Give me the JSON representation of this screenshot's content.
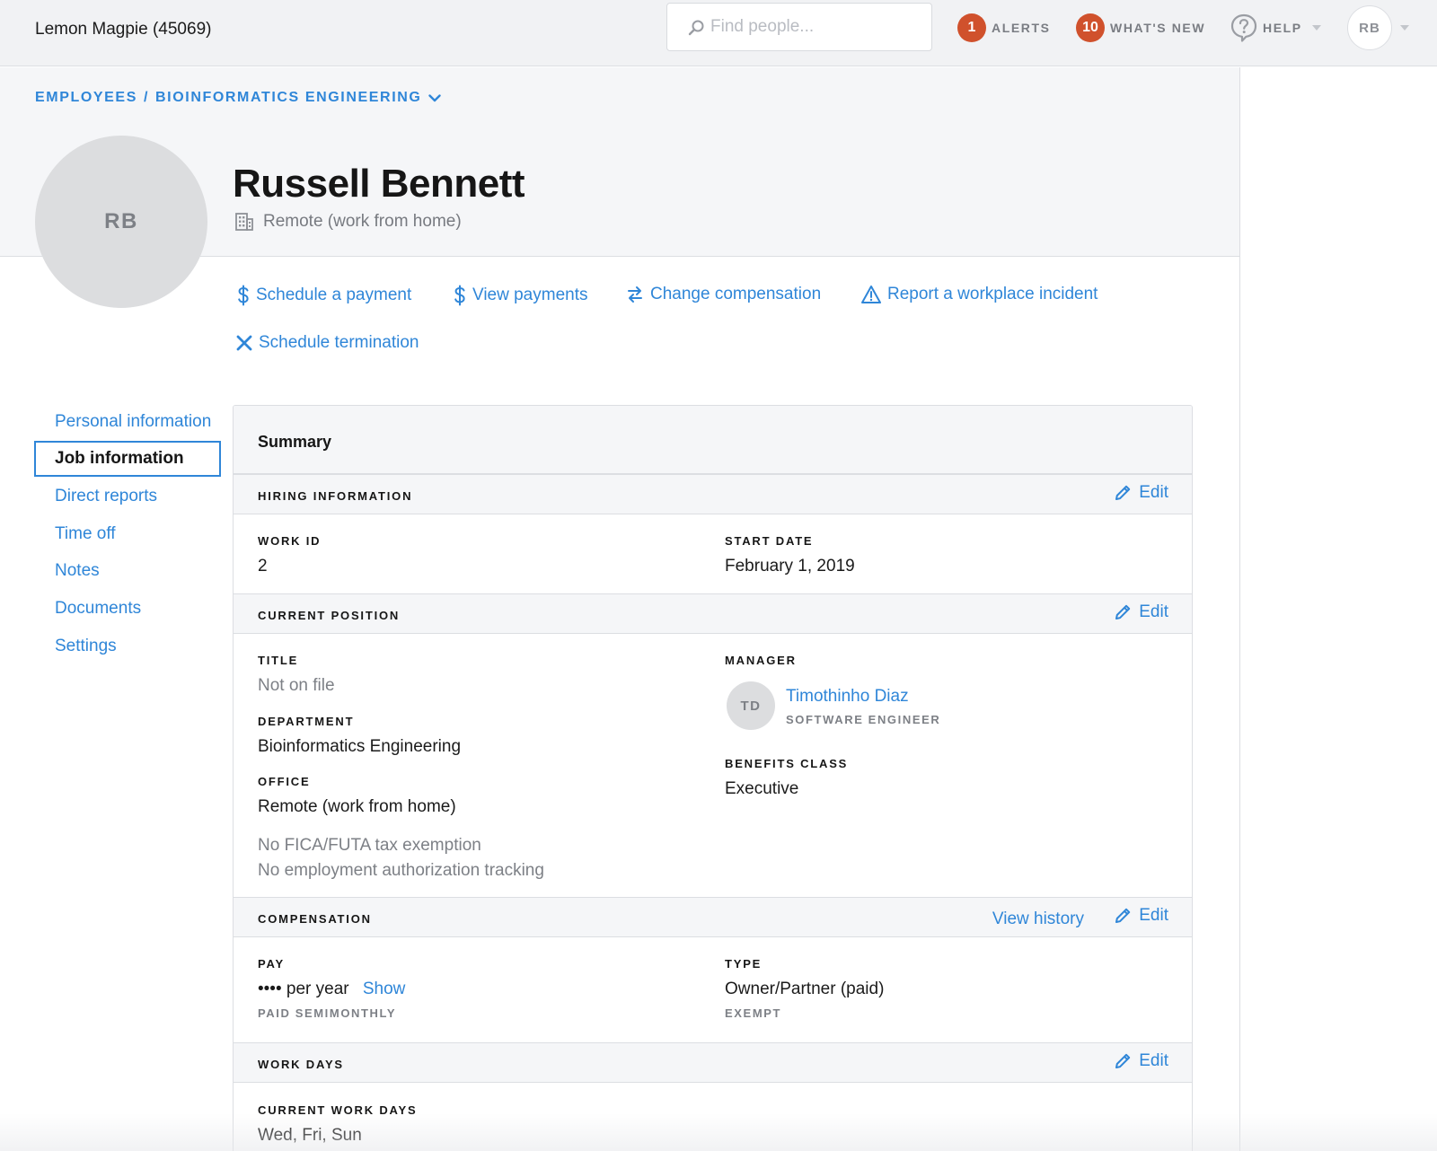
{
  "topbar": {
    "company": "Lemon Magpie (45069)",
    "search_placeholder": "Find people...",
    "alerts": {
      "count": "1",
      "label": "ALERTS"
    },
    "whats_new": {
      "count": "10",
      "label": "WHAT'S NEW"
    },
    "help": {
      "label": "HELP"
    },
    "user_initials": "RB"
  },
  "breadcrumb": {
    "root": "EMPLOYEES",
    "separator": "/",
    "current": "BIOINFORMATICS ENGINEERING"
  },
  "profile": {
    "initials": "RB",
    "name": "Russell Bennett",
    "location": "Remote (work from home)"
  },
  "actions": {
    "schedule_payment": "Schedule a payment",
    "view_payments": "View payments",
    "change_compensation": "Change compensation",
    "report_incident": "Report a workplace incident",
    "schedule_termination": "Schedule termination"
  },
  "sidenav": {
    "items": [
      {
        "label": "Personal information",
        "active": false
      },
      {
        "label": "Job information",
        "active": true
      },
      {
        "label": "Direct reports",
        "active": false
      },
      {
        "label": "Time off",
        "active": false
      },
      {
        "label": "Notes",
        "active": false
      },
      {
        "label": "Documents",
        "active": false
      },
      {
        "label": "Settings",
        "active": false
      }
    ]
  },
  "summary": {
    "title": "Summary",
    "edit_label": "Edit",
    "hiring": {
      "title": "HIRING INFORMATION",
      "work_id_label": "WORK ID",
      "work_id": "2",
      "start_date_label": "START DATE",
      "start_date": "February 1, 2019"
    },
    "position": {
      "title": "CURRENT POSITION",
      "title_label": "TITLE",
      "title_value": "Not on file",
      "department_label": "DEPARTMENT",
      "department": "Bioinformatics Engineering",
      "office_label": "OFFICE",
      "office": "Remote (work from home)",
      "tax_note": "No FICA/FUTA tax exemption",
      "auth_note": "No employment authorization tracking",
      "manager_label": "MANAGER",
      "manager_initials": "TD",
      "manager_name": "Timothinho Diaz",
      "manager_role": "SOFTWARE ENGINEER",
      "benefits_label": "BENEFITS CLASS",
      "benefits": "Executive"
    },
    "compensation": {
      "title": "COMPENSATION",
      "view_history": "View history",
      "pay_label": "PAY",
      "pay_masked": "•••• per year",
      "show_label": "Show",
      "pay_frequency": "PAID SEMIMONTHLY",
      "type_label": "TYPE",
      "type": "Owner/Partner (paid)",
      "exemption": "EXEMPT"
    },
    "work_days": {
      "title": "WORK DAYS",
      "current_label": "CURRENT WORK DAYS",
      "current": "Wed, Fri, Sun"
    }
  },
  "colors": {
    "accent": "#2f86d8",
    "badge": "#d0512c",
    "header_bg": "#f5f6f8",
    "topbar_bg": "#f1f2f4"
  },
  "icons": {
    "search": "search-icon",
    "help": "help-icon",
    "building": "building-icon",
    "dollar": "dollar-icon",
    "swap": "swap-arrows-icon",
    "warning": "warning-triangle-icon",
    "close": "close-icon",
    "pencil": "pencil-icon",
    "caret": "chevron-down-icon"
  }
}
